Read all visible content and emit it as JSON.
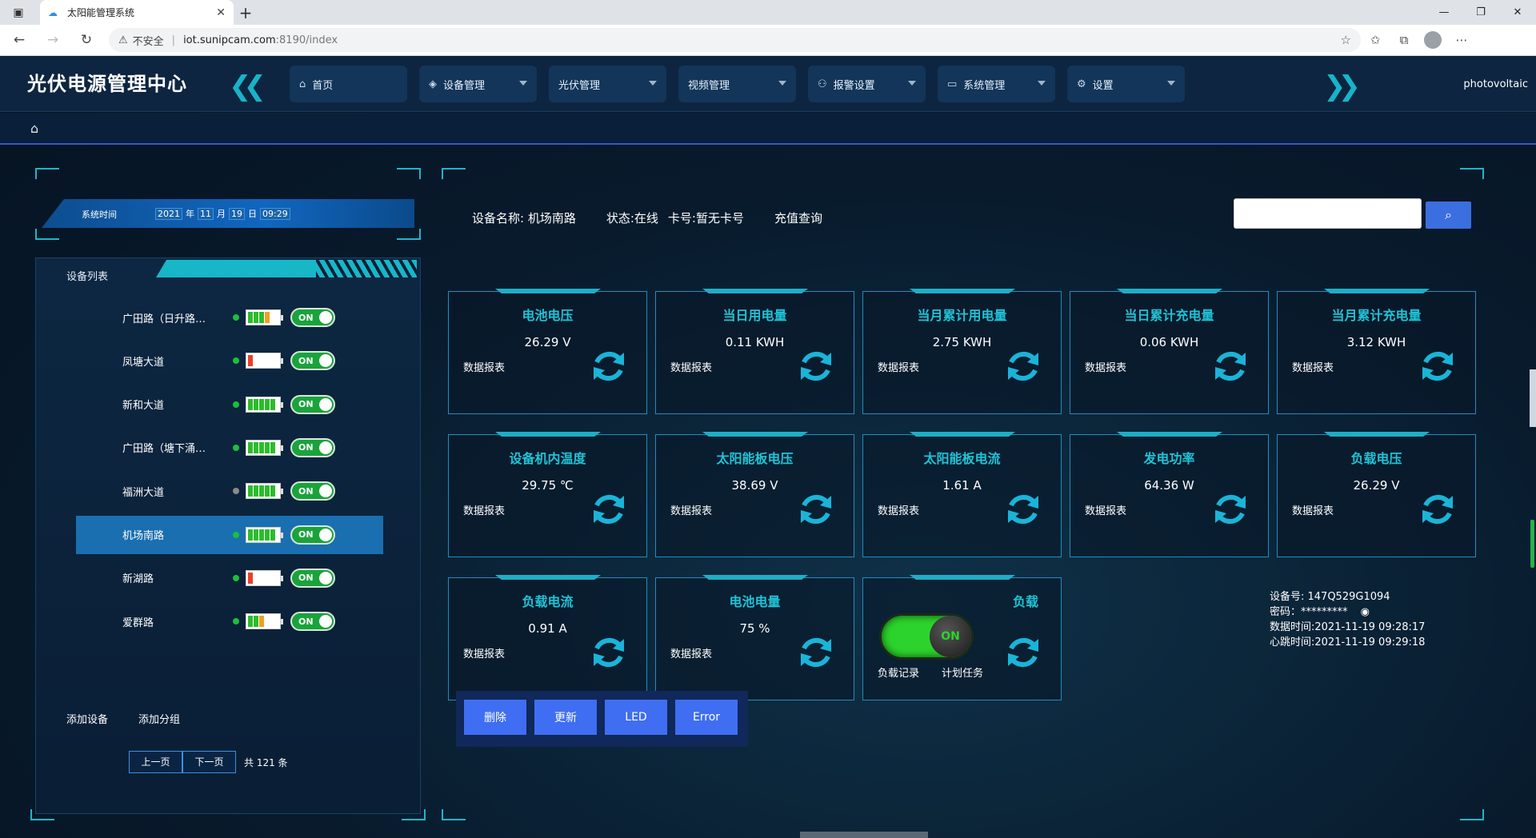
{
  "browser": {
    "tab_title": "太阳能管理系统",
    "url_warning": "不安全",
    "url_host": "iot.sunipcam.com",
    "url_path": ":8190/index"
  },
  "header": {
    "logo": "光伏电源管理中心",
    "user": "photovoltaic",
    "menu": [
      {
        "label": "首页",
        "icon": "home-icon"
      },
      {
        "label": "设备管理",
        "icon": "cube-icon"
      },
      {
        "label": "光伏管理",
        "icon": ""
      },
      {
        "label": "视频管理",
        "icon": ""
      },
      {
        "label": "报警设置",
        "icon": "alarm-icon"
      },
      {
        "label": "系统管理",
        "icon": "monitor-icon"
      },
      {
        "label": "设置",
        "icon": "gear-icon"
      }
    ]
  },
  "time": {
    "label": "系统时间",
    "year": "2021",
    "year_unit": "年",
    "month": "11",
    "month_unit": "月",
    "day": "19",
    "day_unit": "日",
    "clock": "09:29"
  },
  "devices": {
    "title": "设备列表",
    "items": [
      {
        "name": "广田路（日升路…",
        "online": true,
        "battery": 3,
        "battery_colors": [
          "#2dbb2d",
          "#2dbb2d",
          "#2dbb2d",
          "#f0a020"
        ],
        "switch": "ON",
        "active": false
      },
      {
        "name": "凤塘大道",
        "online": true,
        "battery": 1,
        "battery_colors": [
          "#e8402a"
        ],
        "switch": "ON",
        "active": false
      },
      {
        "name": "新和大道",
        "online": true,
        "battery": 5,
        "battery_colors": [
          "#2dbb2d",
          "#2dbb2d",
          "#2dbb2d",
          "#2dbb2d",
          "#2dbb2d"
        ],
        "switch": "ON",
        "active": false
      },
      {
        "name": "广田路（塘下涌…",
        "online": true,
        "battery": 5,
        "battery_colors": [
          "#2dbb2d",
          "#2dbb2d",
          "#2dbb2d",
          "#2dbb2d",
          "#2dbb2d"
        ],
        "switch": "ON",
        "active": false
      },
      {
        "name": "福洲大道",
        "online": false,
        "battery": 5,
        "battery_colors": [
          "#2dbb2d",
          "#2dbb2d",
          "#2dbb2d",
          "#2dbb2d",
          "#2dbb2d"
        ],
        "switch": "ON",
        "active": false
      },
      {
        "name": "机场南路",
        "online": true,
        "battery": 5,
        "battery_colors": [
          "#2dbb2d",
          "#2dbb2d",
          "#2dbb2d",
          "#2dbb2d",
          "#2dbb2d"
        ],
        "switch": "ON",
        "active": true
      },
      {
        "name": "新湖路",
        "online": true,
        "battery": 1,
        "battery_colors": [
          "#e8402a"
        ],
        "switch": "ON",
        "active": false
      },
      {
        "name": "爱群路",
        "online": true,
        "battery": 3,
        "battery_colors": [
          "#2dbb2d",
          "#2dbb2d",
          "#f0a020"
        ],
        "switch": "ON",
        "active": false
      }
    ],
    "add_device": "添加设备",
    "add_group": "添加分组",
    "prev": "上一页",
    "next": "下一页",
    "total": "共 121 条"
  },
  "device_info": {
    "name": "设备名称: 机场南路",
    "status": "状态:在线",
    "card": "卡号:暂无卡号",
    "recharge": "充值查询"
  },
  "cards": [
    {
      "title": "电池电压",
      "value": "26.29 V",
      "report": "数据报表"
    },
    {
      "title": "当日用电量",
      "value": "0.11 KWH",
      "report": "数据报表"
    },
    {
      "title": "当月累计用电量",
      "value": "2.75 KWH",
      "report": "数据报表"
    },
    {
      "title": "当日累计充电量",
      "value": "0.06 KWH",
      "report": "数据报表"
    },
    {
      "title": "当月累计充电量",
      "value": "3.12 KWH",
      "report": "数据报表"
    },
    {
      "title": "设备机内温度",
      "value": "29.75 ℃",
      "report": "数据报表"
    },
    {
      "title": "太阳能板电压",
      "value": "38.69 V",
      "report": "数据报表"
    },
    {
      "title": "太阳能板电流",
      "value": "1.61 A",
      "report": "数据报表"
    },
    {
      "title": "发电功率",
      "value": "64.36 W",
      "report": "数据报表"
    },
    {
      "title": "负载电压",
      "value": "26.29 V",
      "report": "数据报表"
    },
    {
      "title": "负载电流",
      "value": "0.91 A",
      "report": "数据报表"
    },
    {
      "title": "电池电量",
      "value": "75 %",
      "report": "数据报表"
    }
  ],
  "load_card": {
    "title": "负载",
    "switch": "ON",
    "record": "负载记录",
    "task": "计划任务"
  },
  "actions": [
    "删除",
    "更新",
    "LED",
    "Error"
  ],
  "meta": {
    "device_no": "设备号: 147Q529G1094",
    "password": "密码：*********",
    "data_time": "数据时间:2021-11-19 09:28:17",
    "heartbeat": "心跳时间:2021-11-19 09:29:18"
  },
  "colors": {
    "accent": "#20c3d6",
    "nav": "#123559",
    "button": "#3f6ef2",
    "online": "#19c03a"
  }
}
